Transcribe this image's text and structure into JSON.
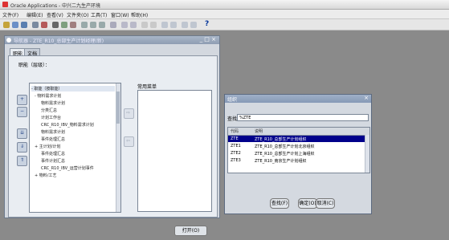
{
  "app": {
    "title": "Oracle Applications - 中兴二九生产环境"
  },
  "menu": [
    "文件(F)",
    "编辑(E)",
    "查看(V)",
    "文件夹(O)",
    "工具(T)",
    "窗口(W)",
    "帮助(H)"
  ],
  "toolbar": {
    "help_label": "?"
  },
  "navigator": {
    "title": "导航器 - ZTE_R10_总部生产计划经理(新)",
    "window_controls": "_ □ ×",
    "tabs": [
      "职能",
      "文档"
    ],
    "function_label": "职能（层级）：",
    "tree": [
      "- 职能（按职能）",
      "- 物料需求计划",
      "物料需求计划",
      "分类汇总",
      "计划工作台",
      "CRC_R10_IBV_物料需求计划",
      "物料需求计划",
      "事件处理汇总",
      "+ 主计划/计划",
      "事件处理汇总",
      "事件计划汇总",
      "CRC_R10_IBV_运营计划事件",
      "+ 物料/工艺"
    ],
    "top_label": "常用菜单",
    "open_button": "打开(O)"
  },
  "lov": {
    "title": "组织",
    "window_controls": "×",
    "find_label": "查找",
    "find_value": "%ZTE",
    "columns": [
      "代码",
      "说明"
    ],
    "rows": [
      {
        "code": "ZTE",
        "desc": "ZTE_R10_总部生产计划组织",
        "selected": true
      },
      {
        "code": "ZTE1",
        "desc": "ZTE_R10_总部生产计划北京组织",
        "selected": false
      },
      {
        "code": "ZTE2",
        "desc": "ZTE_R10_总部生产计划上海组织",
        "selected": false
      },
      {
        "code": "ZTE3",
        "desc": "ZTE_R10_南京生产计划组织",
        "selected": false
      }
    ],
    "buttons": [
      "查找(F)",
      "确定(O)",
      "取消(C)"
    ]
  },
  "colors": {
    "mdi_bg": "#8a8a8a",
    "selection": "#00008b",
    "titlebar": "#8e9db3"
  }
}
